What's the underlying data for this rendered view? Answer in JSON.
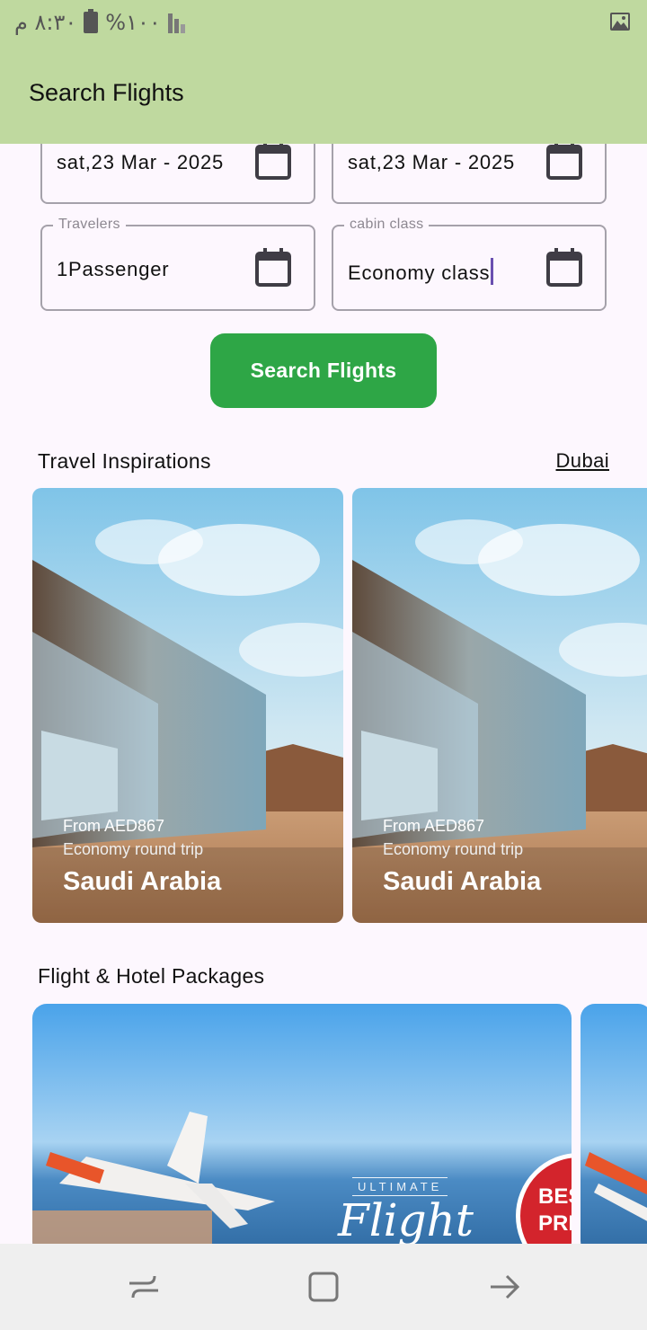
{
  "status_bar": {
    "time": "٨:٣٠ م",
    "battery": "%١٠٠"
  },
  "app_bar": {
    "title": "Search Flights"
  },
  "form": {
    "depart_date": "sat,23 Mar - 2025",
    "return_date": "sat,23 Mar - 2025",
    "travelers_label": "Travelers",
    "travelers_value": "1Passenger",
    "cabin_label": "cabin class",
    "cabin_value": "Economy class",
    "search_button": "Search Flights"
  },
  "inspirations": {
    "title": "Travel Inspirations",
    "city_link": "Dubai",
    "cards": [
      {
        "price": "From AED867",
        "trip": "Economy round trip",
        "destination": "Saudi Arabia"
      },
      {
        "price": "From AED867",
        "trip": "Economy round trip",
        "destination": "Saudi Arabia"
      }
    ]
  },
  "packages": {
    "title": "Flight & Hotel Packages",
    "banner": {
      "tag": "ULTIMATE",
      "script": "Flight",
      "badge_line1": "BES",
      "badge_line2": "PRI"
    }
  },
  "colors": {
    "app_bar": "#bfd99f",
    "primary_button": "#2ea646",
    "background": "#fdf7fe"
  },
  "icons": [
    "gallery-icon",
    "calendar-icon",
    "recent-apps-icon",
    "home-icon",
    "back-icon"
  ]
}
